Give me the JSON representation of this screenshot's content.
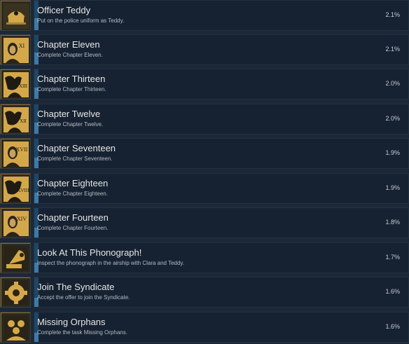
{
  "achievements": [
    {
      "title": "Officer Teddy",
      "description": "Put on the police uniform as Teddy.",
      "percent": "2.1%",
      "fill": 0.021,
      "icon": "police-hat-icon",
      "numeral": ""
    },
    {
      "title": "Chapter Eleven",
      "description": "Complete Chapter Eleven.",
      "percent": "2.1%",
      "fill": 0.021,
      "icon": "chapter-portrait-icon",
      "numeral": "XI"
    },
    {
      "title": "Chapter Thirteen",
      "description": "Complete Chapter Thirteen.",
      "percent": "2.0%",
      "fill": 0.02,
      "icon": "chapter-silhouette-icon",
      "numeral": "XIII"
    },
    {
      "title": "Chapter Twelve",
      "description": "Complete Chapter Twelve.",
      "percent": "2.0%",
      "fill": 0.02,
      "icon": "chapter-silhouette-icon",
      "numeral": "XII"
    },
    {
      "title": "Chapter Seventeen",
      "description": "Complete Chapter Seventeen.",
      "percent": "1.9%",
      "fill": 0.019,
      "icon": "chapter-portrait-icon",
      "numeral": "XVII"
    },
    {
      "title": "Chapter Eighteen",
      "description": "Complete Chapter Eighteen.",
      "percent": "1.9%",
      "fill": 0.019,
      "icon": "chapter-silhouette-icon",
      "numeral": "XVIII"
    },
    {
      "title": "Chapter Fourteen",
      "description": "Complete Chapter Fourteen.",
      "percent": "1.8%",
      "fill": 0.018,
      "icon": "chapter-portrait-icon",
      "numeral": "XIV"
    },
    {
      "title": "Look At This Phonograph!",
      "description": "Inspect the phonograph in the airship with Clara and Teddy.",
      "percent": "1.7%",
      "fill": 0.017,
      "icon": "phonograph-icon",
      "numeral": ""
    },
    {
      "title": "Join The Syndicate",
      "description": "Accept the offer to join the Syndicate.",
      "percent": "1.6%",
      "fill": 0.016,
      "icon": "syndicate-gear-icon",
      "numeral": ""
    },
    {
      "title": "Missing Orphans",
      "description": "Complete the task Missing Orphans.",
      "percent": "1.6%",
      "fill": 0.016,
      "icon": "orphans-icon",
      "numeral": ""
    }
  ],
  "colors": {
    "background": "#1b2838",
    "panel": "#162231",
    "progress_track": "#1d4766",
    "progress_fill": "#3d7aa8",
    "icon_gold": "#d4a84a"
  }
}
